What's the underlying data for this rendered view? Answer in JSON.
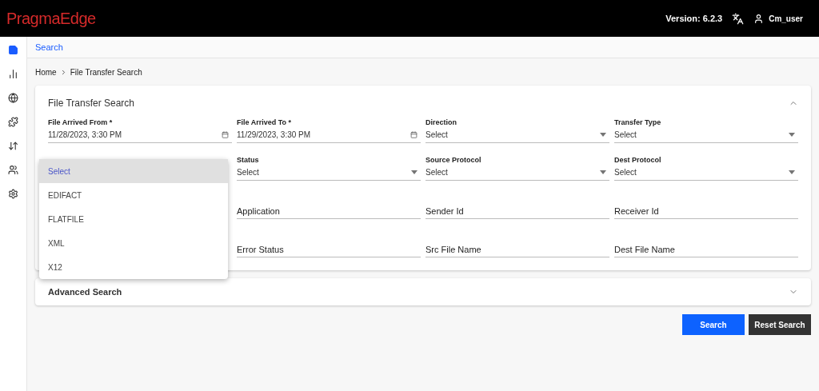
{
  "header": {
    "logo": "PragmaEdge",
    "version": "Version: 6.2.3",
    "user": "Cm_user"
  },
  "nav_items": [
    {
      "selected": true
    },
    {
      "selected": false
    },
    {
      "selected": false
    },
    {
      "selected": false
    },
    {
      "selected": false
    },
    {
      "selected": false
    },
    {
      "selected": false
    }
  ],
  "page_title": "Search",
  "breadcrumb": [
    "Home",
    "File Transfer Search"
  ],
  "panel": {
    "title": "File Transfer Search",
    "expanded": true,
    "rows": [
      [
        {
          "kind": "date",
          "label": "File Arrived From *",
          "value": "11/28/2023, 3:30 PM"
        },
        {
          "kind": "date",
          "label": "File Arrived To *",
          "value": "11/29/2023, 3:30 PM"
        },
        {
          "kind": "select",
          "label": "Direction",
          "value": "Select"
        },
        {
          "kind": "select",
          "label": "Transfer Type",
          "value": "Select"
        }
      ],
      [
        "",
        {
          "kind": "select",
          "label": "Status",
          "value": "Select"
        },
        {
          "kind": "select",
          "label": "Source Protocol",
          "value": "Select"
        },
        {
          "kind": "select",
          "label": "Dest Protocol",
          "value": "Select"
        }
      ],
      [
        "",
        {
          "kind": "text",
          "placeholder": "Application"
        },
        {
          "kind": "text",
          "placeholder": "Sender Id"
        },
        {
          "kind": "text",
          "placeholder": "Receiver Id"
        }
      ],
      [
        "",
        {
          "kind": "text",
          "placeholder": "Error Status"
        },
        {
          "kind": "text",
          "placeholder": "Src File Name"
        },
        {
          "kind": "text",
          "placeholder": "Dest File Name"
        }
      ]
    ]
  },
  "dropdown_menu": {
    "options": [
      {
        "label": "Select",
        "selected": true
      },
      {
        "label": "EDIFACT",
        "selected": false
      },
      {
        "label": "FLATFILE",
        "selected": false
      },
      {
        "label": "XML",
        "selected": false
      },
      {
        "label": "X12",
        "selected": false
      }
    ]
  },
  "advanced_panel": {
    "title": "Advanced Search",
    "expanded": false
  },
  "buttons": [
    {
      "kind": "primary",
      "label": "Search"
    },
    {
      "kind": "secondary",
      "label": "Reset Search"
    }
  ]
}
